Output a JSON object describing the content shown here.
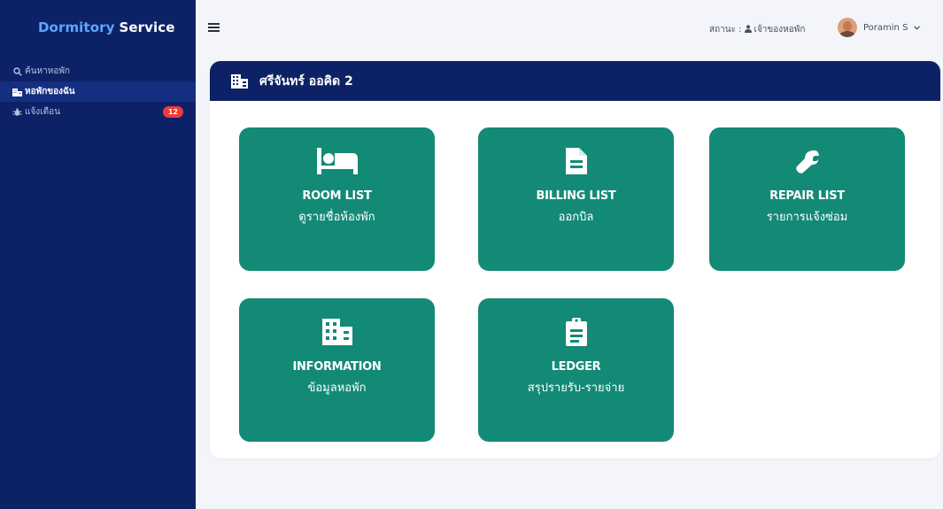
{
  "sidebar": {
    "brand_part1": "Dormitory",
    "brand_part2": "Service",
    "items": [
      {
        "label": "ค้นหาหอพัก",
        "icon": "search-icon"
      },
      {
        "label": "หอพักของฉัน",
        "icon": "building-icon"
      },
      {
        "label": "แจ้งเตือน",
        "icon": "bug-icon",
        "badge": "12"
      }
    ]
  },
  "topbar": {
    "status_label": "สถานะ :",
    "status_value": "เจ้าของหอพัก",
    "user_name": "Poramin S"
  },
  "main": {
    "title": "ศรีจันทร์ ออคิด 2",
    "tiles": [
      {
        "title": "ROOM LIST",
        "subtitle": "ดูรายชื่อห้องพัก",
        "icon": "bed-icon"
      },
      {
        "title": "BILLING LIST",
        "subtitle": "ออกบิล",
        "icon": "file-icon"
      },
      {
        "title": "REPAIR LIST",
        "subtitle": "รายการแจ้งซ่อม",
        "icon": "wrench-icon"
      },
      {
        "title": "INFORMATION",
        "subtitle": "ข้อมูลหอพัก",
        "icon": "building-icon"
      },
      {
        "title": "LEDGER",
        "subtitle": "สรุปรายรับ-รายจ่าย",
        "icon": "clipboard-icon"
      }
    ]
  },
  "colors": {
    "sidebar": "#0d2266",
    "tile": "#138a76",
    "badge": "#ef3b3b",
    "background": "#f3f5fa"
  }
}
